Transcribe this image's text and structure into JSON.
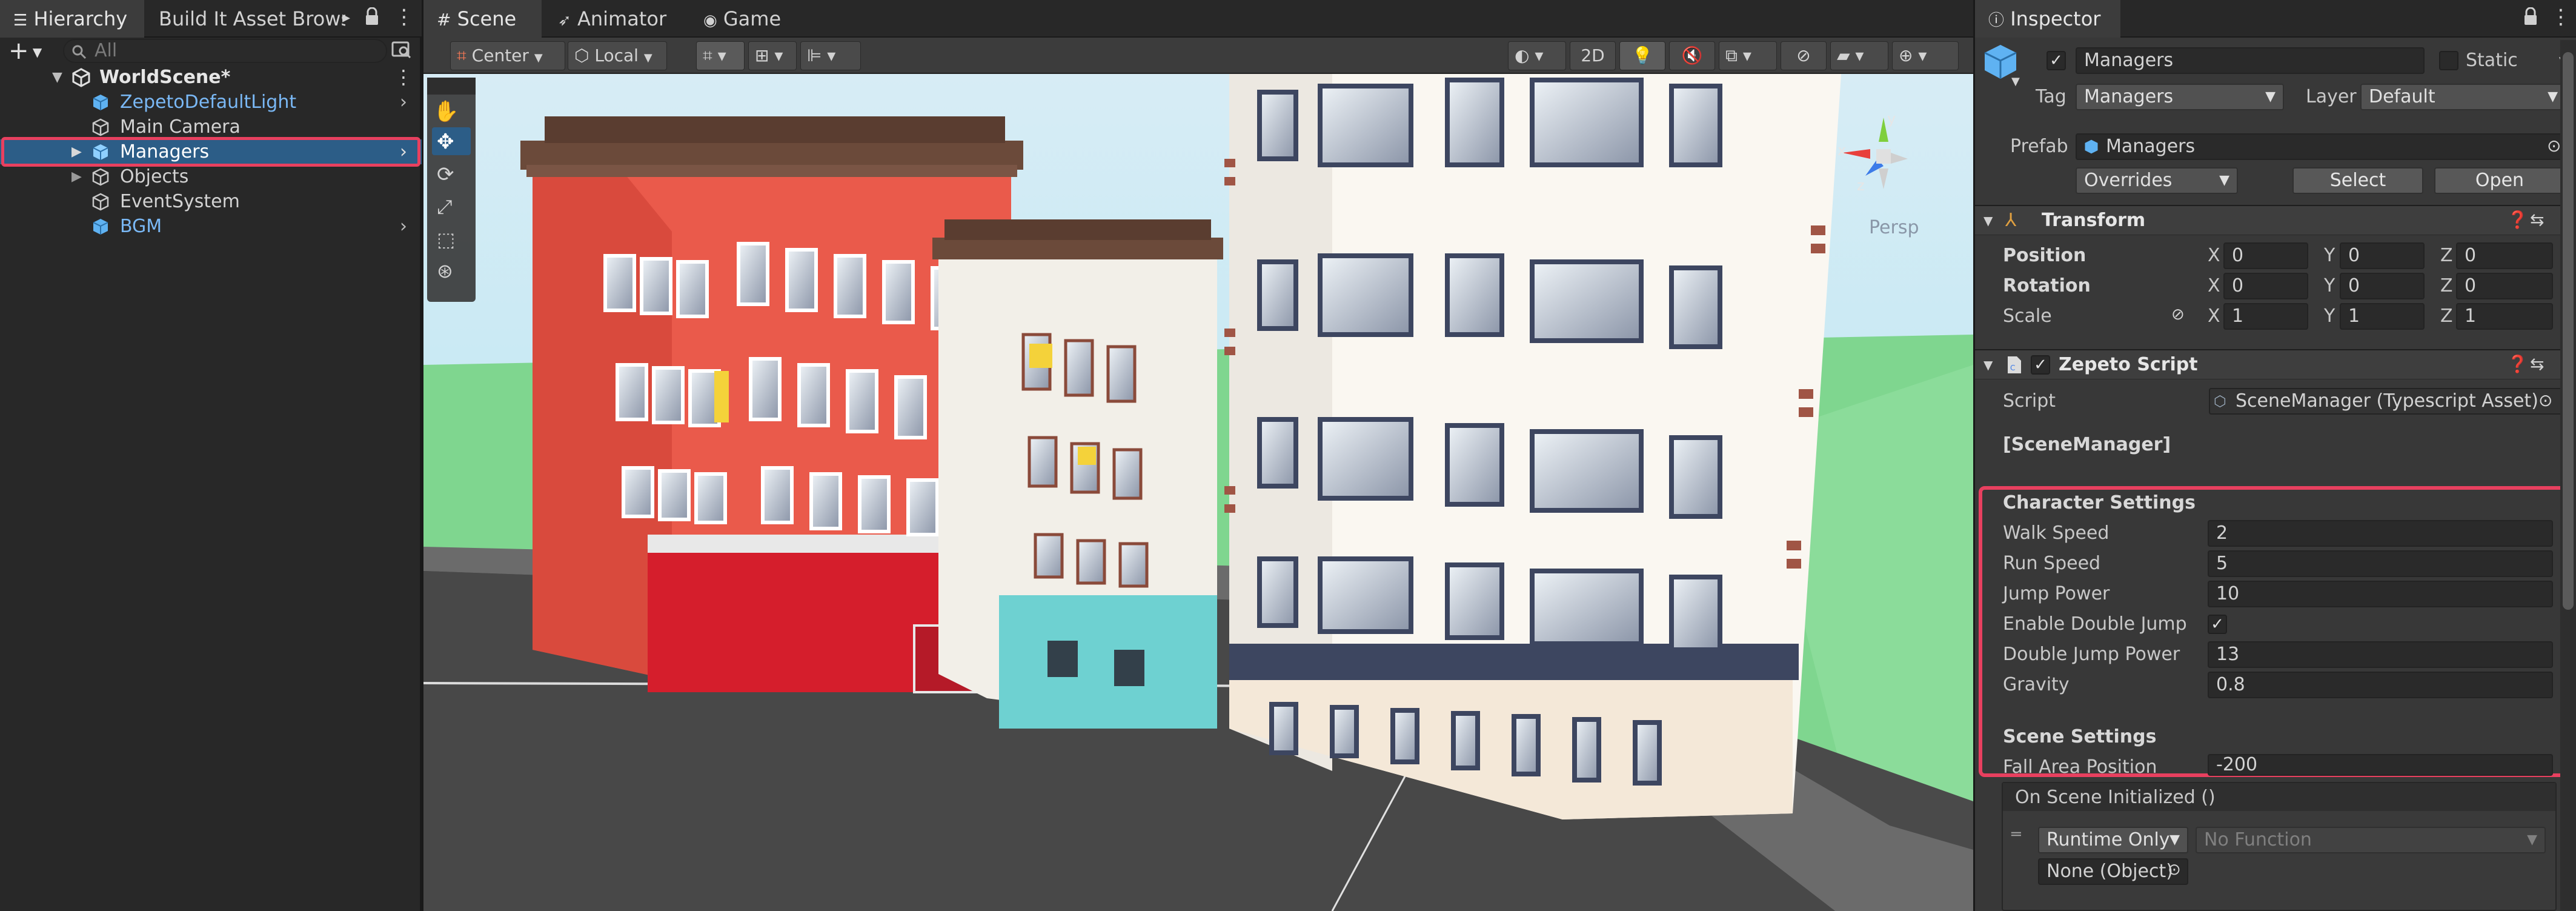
{
  "hierarchy": {
    "tab_label": "Hierarchy",
    "second_tab_label": "Build It Asset Browse",
    "search_placeholder": "All",
    "add_label": "+",
    "items": [
      {
        "label": "WorldScene*"
      },
      {
        "label": "ZepetoDefaultLight"
      },
      {
        "label": "Main Camera"
      },
      {
        "label": "Managers"
      },
      {
        "label": "Objects"
      },
      {
        "label": "EventSystem"
      },
      {
        "label": "BGM"
      }
    ]
  },
  "scene": {
    "tabs": [
      {
        "label": "Scene"
      },
      {
        "label": "Animator"
      },
      {
        "label": "Game"
      }
    ],
    "toolbar": {
      "pivot": "Center",
      "space": "Local",
      "mode_2d": "2D"
    },
    "persp_label": "Persp",
    "gizmo_axes": {
      "y": "y",
      "x": "x",
      "z": "z"
    }
  },
  "inspector": {
    "tab_label": "Inspector",
    "object_name": "Managers",
    "static_label": "Static",
    "tag_label": "Tag",
    "tag_value": "Managers",
    "layer_label": "Layer",
    "layer_value": "Default",
    "prefab_label": "Prefab",
    "prefab_value": "Managers",
    "overrides_label": "Overrides",
    "select_label": "Select",
    "open_label": "Open",
    "transform": {
      "title": "Transform",
      "position_label": "Position",
      "rotation_label": "Rotation",
      "scale_label": "Scale",
      "axis_x": "X",
      "axis_y": "Y",
      "axis_z": "Z",
      "position": {
        "x": "0",
        "y": "0",
        "z": "0"
      },
      "rotation": {
        "x": "0",
        "y": "0",
        "z": "0"
      },
      "scale": {
        "x": "1",
        "y": "1",
        "z": "1"
      }
    },
    "script_component": {
      "title": "Zepeto Script",
      "script_label": "Script",
      "script_value": "SceneManager (Typescript Asset)",
      "class_header": "[SceneManager]",
      "character_header": "Character Settings",
      "walk_speed_label": "Walk Speed",
      "walk_speed": "2",
      "run_speed_label": "Run Speed",
      "run_speed": "5",
      "jump_power_label": "Jump Power",
      "jump_power": "10",
      "double_jump_label": "Enable Double Jump",
      "double_jump_checked": "✓",
      "double_jump_power_label": "Double Jump Power",
      "double_jump_power": "13",
      "gravity_label": "Gravity",
      "gravity": "0.8",
      "scene_header": "Scene Settings",
      "fall_area_label": "Fall Area Position",
      "fall_area": "-200",
      "event_label": "On Scene Initialized ()",
      "runtime_label": "Runtime Only",
      "function_label": "No Function",
      "object_label": "None (Object)"
    }
  },
  "colors": {
    "highlight": "#e8405f",
    "selection": "#2c5d87",
    "prefab_blue": "#7ab8f5"
  }
}
